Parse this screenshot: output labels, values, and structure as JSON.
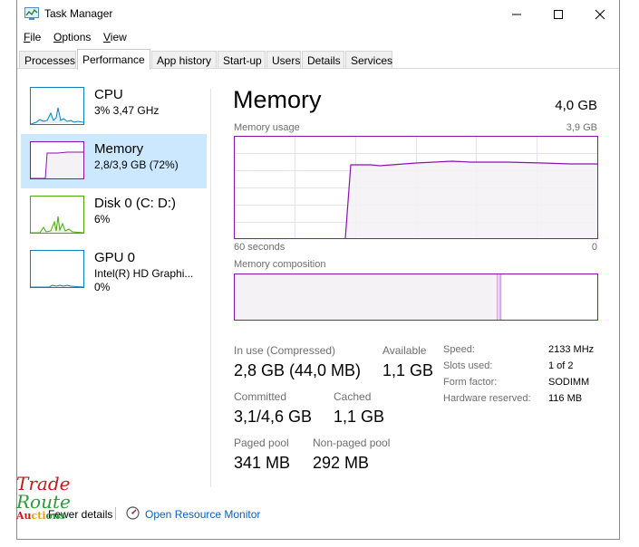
{
  "window": {
    "title": "Task Manager"
  },
  "menu": [
    {
      "key": "F",
      "rest": "ile"
    },
    {
      "key": "O",
      "rest": "ptions"
    },
    {
      "key": "V",
      "rest": "iew"
    }
  ],
  "tabs": [
    "Processes",
    "Performance",
    "App history",
    "Start-up",
    "Users",
    "Details",
    "Services"
  ],
  "active_tab": "Performance",
  "sidebar": [
    {
      "name": "CPU",
      "detail": "3% 3,47 GHz",
      "color": "#117dbb"
    },
    {
      "name": "Memory",
      "detail": "2,8/3,9 GB (72%)",
      "color": "#8b12ae"
    },
    {
      "name": "Disk 0 (C: D:)",
      "detail": "6%",
      "color": "#4da60c"
    },
    {
      "name": "GPU 0",
      "detail": "Intel(R) HD Graphi...",
      "detail2": "0%",
      "color": "#117dbb"
    }
  ],
  "main": {
    "title": "Memory",
    "capacity": "4,0 GB",
    "usage_label": "Memory usage",
    "usage_max": "3,9 GB",
    "axis_left": "60 seconds",
    "axis_right": "0",
    "composition_label": "Memory composition"
  },
  "stats": {
    "in_use_label": "In use (Compressed)",
    "in_use_value": "2,8 GB (44,0 MB)",
    "available_label": "Available",
    "available_value": "1,1 GB",
    "committed_label": "Committed",
    "committed_value": "3,1/4,6 GB",
    "cached_label": "Cached",
    "cached_value": "1,1 GB",
    "paged_label": "Paged pool",
    "paged_value": "341 MB",
    "nonpaged_label": "Non-paged pool",
    "nonpaged_value": "292 MB"
  },
  "specs": [
    {
      "key": "Speed:",
      "value": "2133 MHz"
    },
    {
      "key": "Slots used:",
      "value": "1 of 2"
    },
    {
      "key": "Form factor:",
      "value": "SODIMM"
    },
    {
      "key": "Hardware reserved:",
      "value": "116 MB"
    }
  ],
  "footer": {
    "fewer_details": "Fewer details",
    "open_monitor": "Open Resource Monitor"
  },
  "watermark": {
    "line1": "Trade",
    "line2": "Route",
    "line3": "Auctions"
  },
  "colors": {
    "memory": "#8b12ae",
    "memory_fill": "#f4f2f4",
    "selection": "#cce8ff",
    "link": "#0b5fb7"
  }
}
